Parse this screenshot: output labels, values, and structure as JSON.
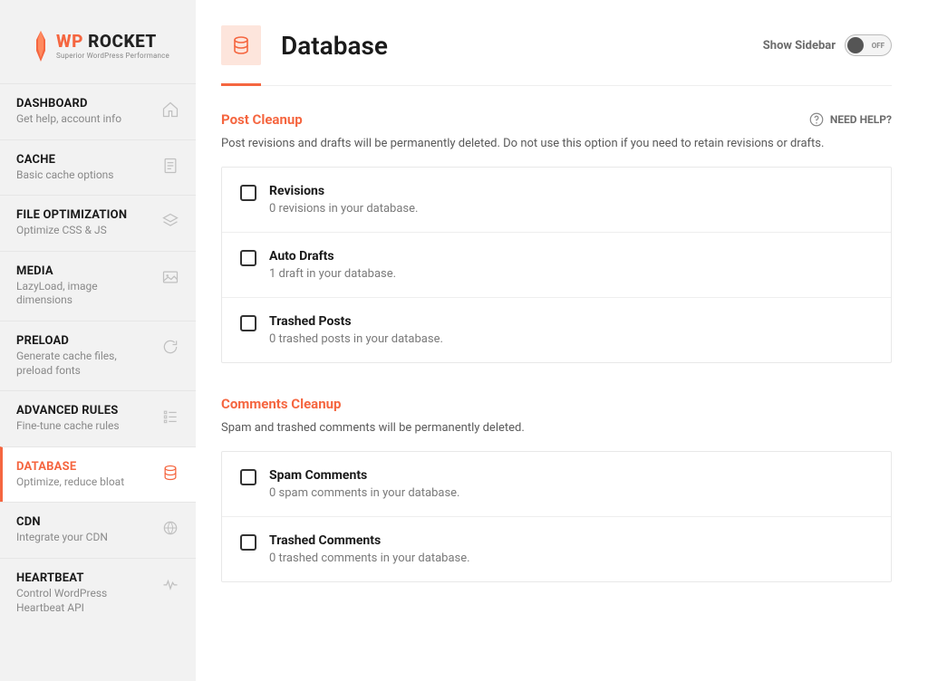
{
  "brand": {
    "wp": "WP",
    "rocket": "ROCKET",
    "tagline": "Superior WordPress Performance"
  },
  "nav": {
    "dashboard": {
      "title": "DASHBOARD",
      "desc": "Get help, account info"
    },
    "cache": {
      "title": "CACHE",
      "desc": "Basic cache options"
    },
    "fileopt": {
      "title": "FILE OPTIMIZATION",
      "desc": "Optimize CSS & JS"
    },
    "media": {
      "title": "MEDIA",
      "desc": "LazyLoad, image dimensions"
    },
    "preload": {
      "title": "PRELOAD",
      "desc": "Generate cache files, preload fonts"
    },
    "advanced": {
      "title": "ADVANCED RULES",
      "desc": "Fine-tune cache rules"
    },
    "database": {
      "title": "DATABASE",
      "desc": "Optimize, reduce bloat"
    },
    "cdn": {
      "title": "CDN",
      "desc": "Integrate your CDN"
    },
    "heartbeat": {
      "title": "HEARTBEAT",
      "desc": "Control WordPress Heartbeat API"
    }
  },
  "header": {
    "title": "Database",
    "show_sidebar": "Show Sidebar",
    "toggle_state": "OFF"
  },
  "help": {
    "label": "NEED HELP?"
  },
  "sections": {
    "post_cleanup": {
      "title": "Post Cleanup",
      "desc": "Post revisions and drafts will be permanently deleted. Do not use this option if you need to retain revisions or drafts.",
      "items": {
        "revisions": {
          "title": "Revisions",
          "desc": "0 revisions in your database."
        },
        "auto_drafts": {
          "title": "Auto Drafts",
          "desc": "1 draft in your database."
        },
        "trashed_posts": {
          "title": "Trashed Posts",
          "desc": "0 trashed posts in your database."
        }
      }
    },
    "comments_cleanup": {
      "title": "Comments Cleanup",
      "desc": "Spam and trashed comments will be permanently deleted.",
      "items": {
        "spam_comments": {
          "title": "Spam Comments",
          "desc": "0 spam comments in your database."
        },
        "trashed_comments": {
          "title": "Trashed Comments",
          "desc": "0 trashed comments in your database."
        }
      }
    }
  }
}
